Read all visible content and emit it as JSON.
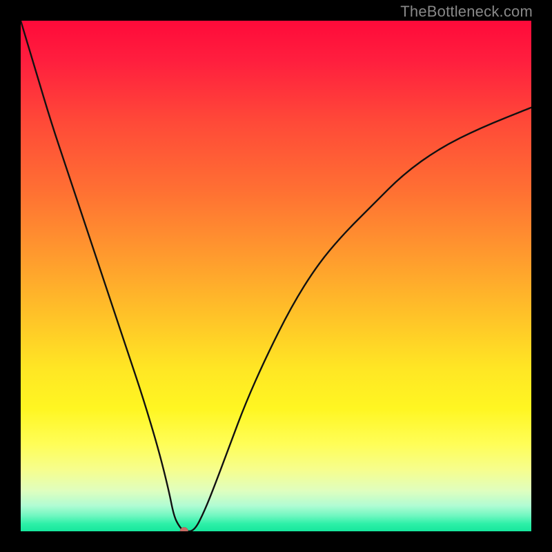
{
  "watermark": "TheBottleneck.com",
  "chart_data": {
    "type": "line",
    "title": "",
    "xlabel": "",
    "ylabel": "",
    "xlim": [
      0,
      100
    ],
    "ylim": [
      0,
      100
    ],
    "legend": false,
    "grid": false,
    "notch": {
      "x": 32,
      "y": 0
    },
    "series": [
      {
        "name": "curve",
        "x": [
          0,
          3,
          6,
          9,
          12,
          15,
          18,
          21,
          24,
          27,
          29,
          30,
          31,
          32,
          34,
          36,
          38,
          41,
          44,
          48,
          53,
          58,
          63,
          69,
          75,
          82,
          90,
          100
        ],
        "values": [
          100,
          90,
          80,
          71,
          62,
          53,
          44,
          35,
          26,
          16,
          8,
          3,
          1,
          0,
          0,
          4,
          9,
          17,
          25,
          34,
          44,
          52,
          58,
          64,
          70,
          75,
          79,
          83
        ]
      }
    ],
    "background_gradient": {
      "top": "#ff0a3a",
      "mid": "#ffe624",
      "bottom": "#16e79d"
    }
  }
}
